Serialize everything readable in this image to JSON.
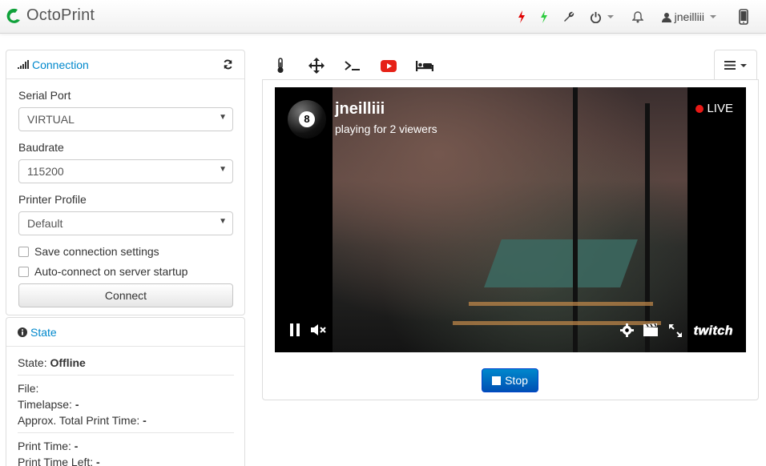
{
  "app": {
    "title": "OctoPrint",
    "username": "jneilliii"
  },
  "connection": {
    "title": "Connection",
    "serial_port_label": "Serial Port",
    "serial_port_value": "VIRTUAL",
    "baudrate_label": "Baudrate",
    "baudrate_value": "115200",
    "profile_label": "Printer Profile",
    "profile_value": "Default",
    "save_settings_label": "Save connection settings",
    "autoconnect_label": "Auto-connect on server startup",
    "connect_button": "Connect"
  },
  "state": {
    "title": "State",
    "state_label": "State:",
    "state_value": "Offline",
    "file_label": "File:",
    "timelapse_label": "Timelapse:",
    "timelapse_value": "-",
    "approx_label": "Approx. Total Print Time:",
    "approx_value": "-",
    "print_time_label": "Print Time:",
    "print_time_value": "-",
    "print_time_left_label": "Print Time Left:",
    "print_time_left_value": "-"
  },
  "stream": {
    "channel": "jneilliii",
    "subtitle": "playing for 2 viewers",
    "live_label": "LIVE",
    "avatar_number": "8",
    "brand": "twitch"
  },
  "stop_button": "Stop",
  "colors": {
    "accent": "#0088cc",
    "youtube_red": "#e62117",
    "bolt_red": "#e00000",
    "bolt_green": "#2ecc40",
    "live_red": "#e91916",
    "brand_green": "#0fa13a"
  },
  "icons": {
    "nav": [
      "bolt-red-icon",
      "bolt-green-icon",
      "wrench-icon",
      "power-icon",
      "bell-icon",
      "user-icon",
      "mobile-icon"
    ],
    "tabs": [
      "thermometer-icon",
      "move-icon",
      "terminal-icon",
      "youtube-icon",
      "bed-icon"
    ]
  }
}
